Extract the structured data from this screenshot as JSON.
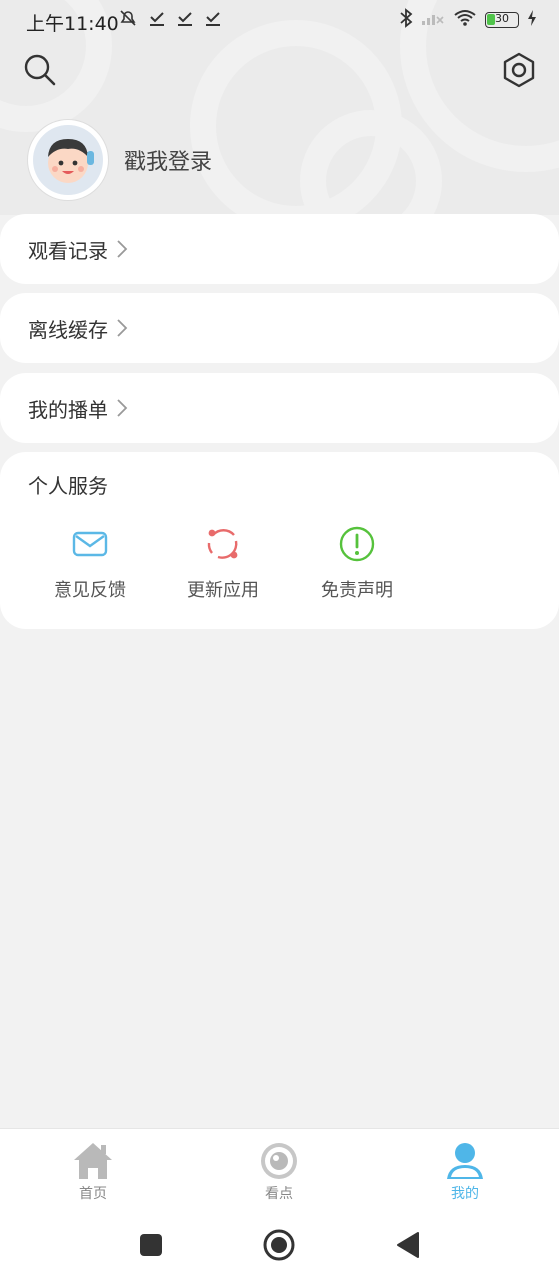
{
  "status_bar": {
    "time": "上午11:40",
    "battery": "30"
  },
  "profile": {
    "login_text": "戳我登录"
  },
  "menu": {
    "items": [
      {
        "label": "观看记录"
      },
      {
        "label": "离线缓存"
      },
      {
        "label": "我的播单"
      }
    ]
  },
  "services": {
    "title": "个人服务",
    "items": [
      {
        "label": "意见反馈",
        "icon": "mail-icon",
        "color": "#5bb8e6"
      },
      {
        "label": "更新应用",
        "icon": "refresh-icon",
        "color": "#e86b6b"
      },
      {
        "label": "免责声明",
        "icon": "exclamation-icon",
        "color": "#56c23c"
      }
    ]
  },
  "tabbar": {
    "tabs": [
      {
        "label": "首页",
        "icon": "home-icon"
      },
      {
        "label": "看点",
        "icon": "eye-icon"
      },
      {
        "label": "我的",
        "icon": "user-icon",
        "active": true
      }
    ],
    "active_color": "#4fb6e8"
  }
}
